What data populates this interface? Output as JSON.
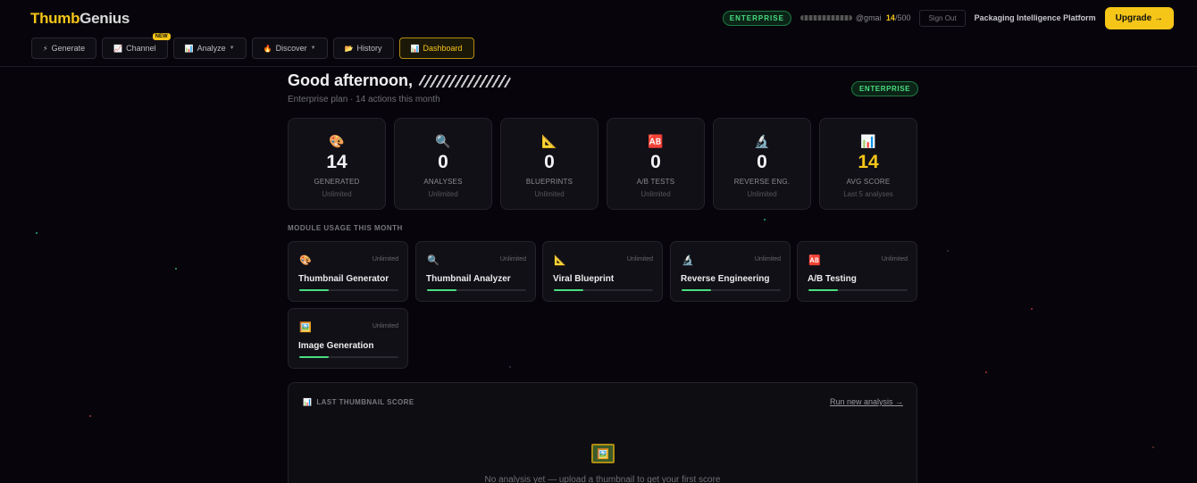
{
  "app": {
    "logo_part1": "Thumb",
    "logo_part2": "Genius"
  },
  "header": {
    "plan_badge": "ENTERPRISE",
    "email_visible": "@gmai",
    "usage_count": "14",
    "usage_limit": "/500",
    "signout_label": "Sign Out",
    "platform_label": "Packaging Intelligence Platform",
    "upgrade_label": "Upgrade →"
  },
  "nav": {
    "items": [
      {
        "label": "Generate",
        "icon": "⚡"
      },
      {
        "label": "Channel",
        "icon": "📈",
        "badge": "NEW"
      },
      {
        "label": "Analyze",
        "icon": "📊"
      },
      {
        "label": "Discover",
        "icon": "🔥"
      },
      {
        "label": "History",
        "icon": "📂"
      },
      {
        "label": "Dashboard",
        "icon": "📊"
      }
    ],
    "active": "Dashboard"
  },
  "main": {
    "greeting": "Good afternoon,",
    "subtitle": "Enterprise plan · 14 actions this month",
    "plan_badge": "ENTERPRISE",
    "stats": [
      {
        "icon": "🎨",
        "value": "14",
        "label": "GENERATED",
        "sub": "Unlimited"
      },
      {
        "icon": "🔍",
        "value": "0",
        "label": "ANALYSES",
        "sub": "Unlimited"
      },
      {
        "icon": "📐",
        "value": "0",
        "label": "BLUEPRINTS",
        "sub": "Unlimited"
      },
      {
        "icon": "🆎",
        "value": "0",
        "label": "A/B TESTS",
        "sub": "Unlimited"
      },
      {
        "icon": "🔬",
        "value": "0",
        "label": "REVERSE ENG.",
        "sub": "Unlimited"
      },
      {
        "icon": "📊",
        "value": "14",
        "label": "AVG SCORE",
        "sub": "Last 5 analyses"
      }
    ],
    "module_heading": "MODULE USAGE THIS MONTH",
    "modules": [
      {
        "icon": "🎨",
        "name": "Thumbnail Generator",
        "limit": "Unlimited",
        "progress": 0.3
      },
      {
        "icon": "🔍",
        "name": "Thumbnail Analyzer",
        "limit": "Unlimited",
        "progress": 0.3
      },
      {
        "icon": "📐",
        "name": "Viral Blueprint",
        "limit": "Unlimited",
        "progress": 0.3
      },
      {
        "icon": "🔬",
        "name": "Reverse Engineering",
        "limit": "Unlimited",
        "progress": 0.3
      },
      {
        "icon": "🆎",
        "name": "A/B Testing",
        "limit": "Unlimited",
        "progress": 0.3
      },
      {
        "icon": "🖼️",
        "name": "Image Generation",
        "limit": "Unlimited",
        "progress": 0.3
      }
    ],
    "last_score": {
      "icon": "📊",
      "heading": "LAST THUMBNAIL SCORE",
      "link": "Run new analysis →",
      "image_icon": "🖼️",
      "empty_text": "No analysis yet — upload a thumbnail to get your first score"
    }
  },
  "colors": {
    "accent": "#f5c518",
    "success": "#4ade80",
    "background": "#07050b"
  }
}
